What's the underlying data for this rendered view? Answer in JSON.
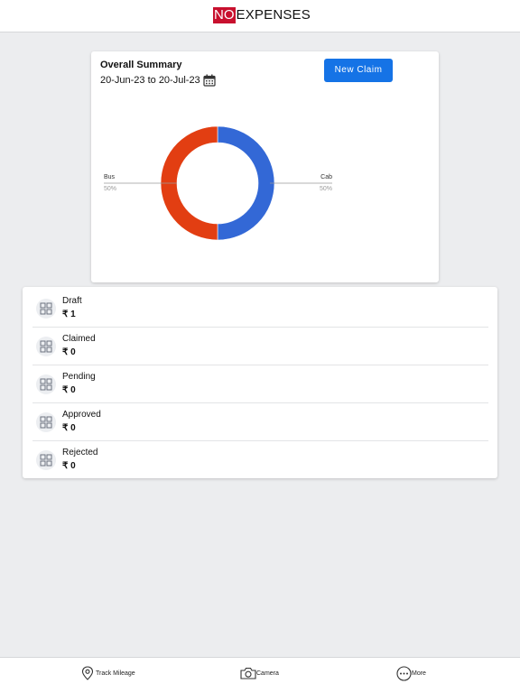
{
  "header": {
    "logo_box": "NO",
    "logo_text": "EXPENSES"
  },
  "summary": {
    "title": "Overall Summary",
    "date_range": "20-Jun-23 to 20-Jul-23",
    "new_claim_label": "New Claim"
  },
  "chart_data": {
    "type": "pie",
    "donut": true,
    "categories": [
      "Bus",
      "Cab"
    ],
    "values": [
      50,
      50
    ],
    "percent_labels": [
      "50%",
      "50%"
    ],
    "colors": [
      "#e23e12",
      "#3368d6"
    ],
    "legend": "none"
  },
  "statuses": [
    {
      "label": "Draft",
      "amount": "₹ 1"
    },
    {
      "label": "Claimed",
      "amount": "₹ 0"
    },
    {
      "label": "Pending",
      "amount": "₹ 0"
    },
    {
      "label": "Approved",
      "amount": "₹ 0"
    },
    {
      "label": "Rejected",
      "amount": "₹ 0"
    }
  ],
  "nav": {
    "track_mileage": "Track Mileage",
    "camera": "Camera",
    "more": "More"
  },
  "icons": {
    "calendar": "calendar-icon",
    "status": "grid-icon",
    "track_mileage": "location-pin-icon",
    "camera": "camera-icon",
    "more": "more-dots-icon"
  }
}
